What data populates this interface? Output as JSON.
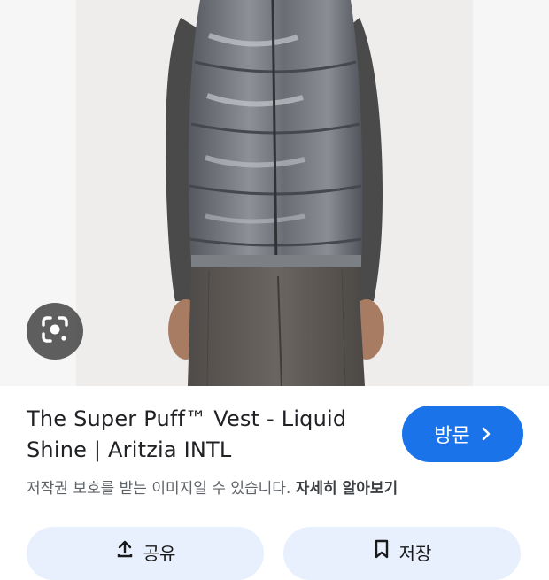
{
  "product": {
    "title_line1": "The Super Puff™ Vest - Liquid",
    "title_line2": "Shine | Aritzia INTL"
  },
  "visit_button": {
    "label": "방문",
    "icon": "chevron-right-icon"
  },
  "notice": {
    "text": "저작권 보호를 받는 이미지일 수 있습니다.",
    "link": "자세히 알아보기"
  },
  "actions": {
    "share_label": "공유",
    "save_label": "저장"
  },
  "lens": {
    "icon": "lens-camera-icon"
  },
  "colors": {
    "accent": "#1a73e8",
    "chip_bg": "#e8f0fe",
    "vest": "#6f7379",
    "sweater": "#4a4a4a",
    "trousers": "#5e5a57"
  }
}
